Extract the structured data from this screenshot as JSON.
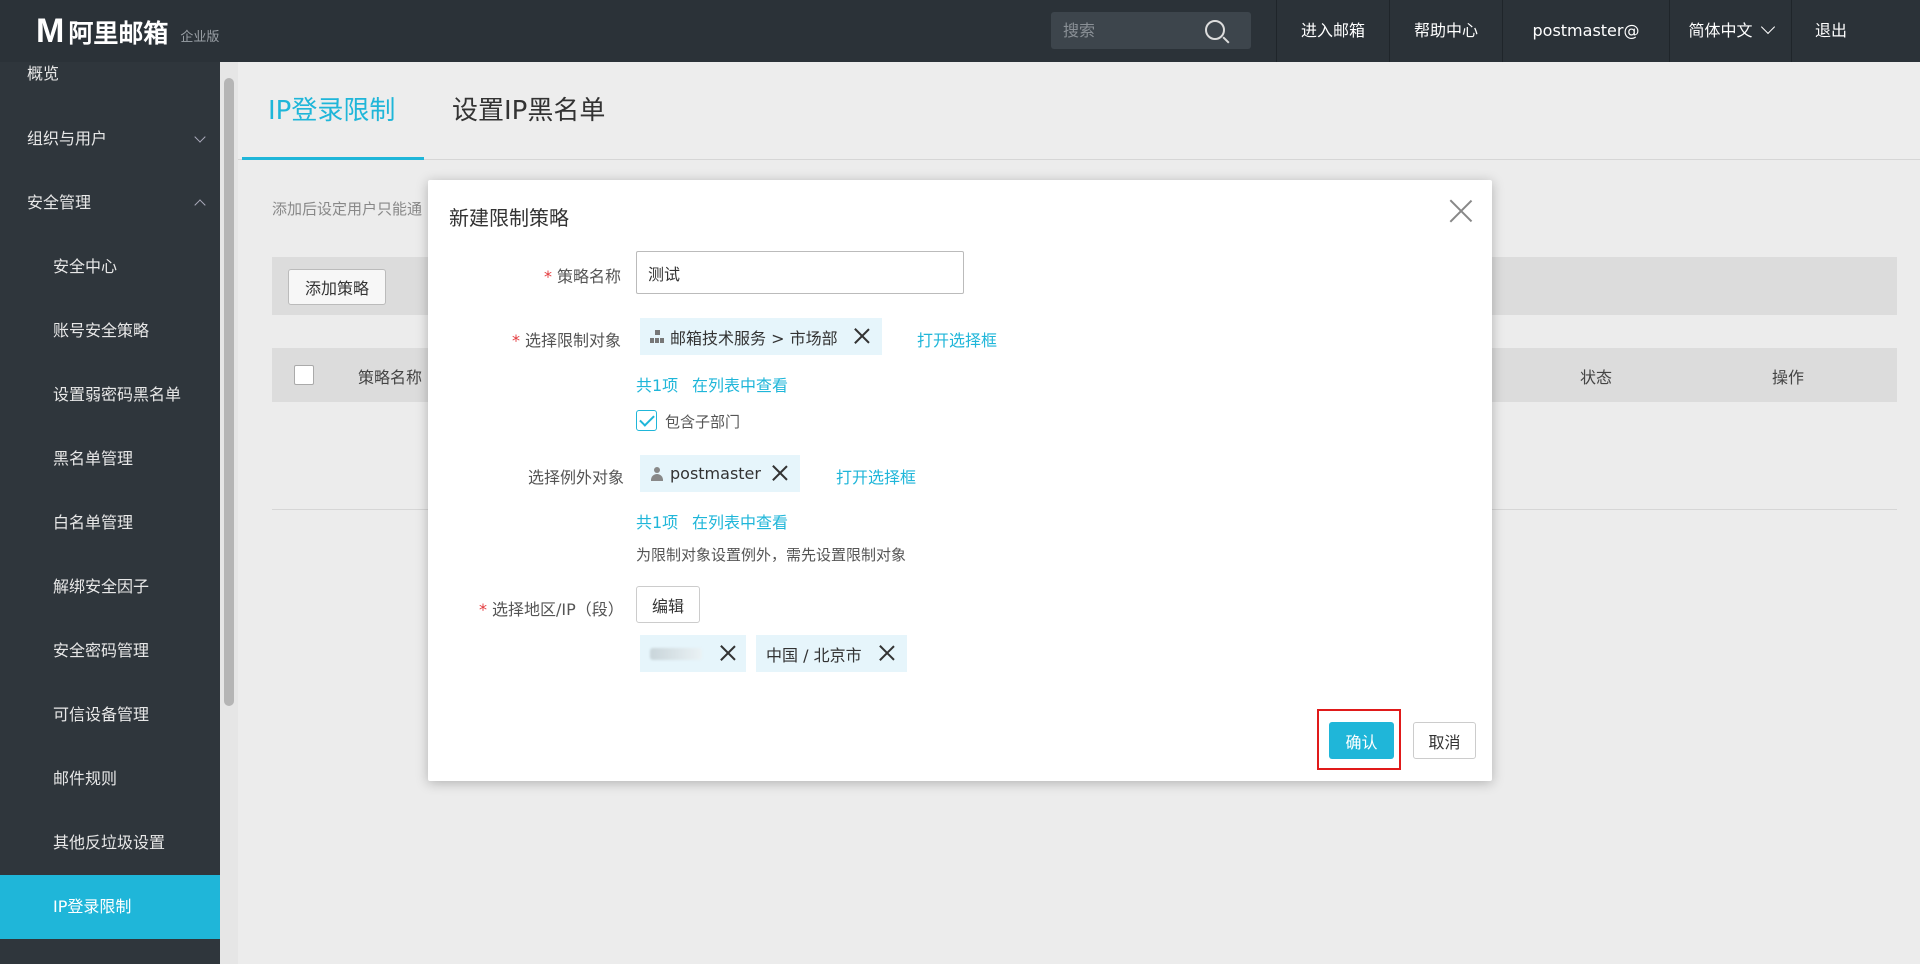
{
  "header": {
    "logo_mark": "M",
    "logo_text": "阿里邮箱",
    "logo_sub": "企业版",
    "search_placeholder": "搜索",
    "nav": [
      "进入邮箱",
      "帮助中心",
      "postmaster@",
      "简体中文",
      "退出"
    ]
  },
  "sidebar": {
    "items": [
      {
        "label": "概览"
      },
      {
        "label": "组织与用户"
      },
      {
        "label": "安全管理"
      },
      {
        "label": "安全中心"
      },
      {
        "label": "账号安全策略"
      },
      {
        "label": "设置弱密码黑名单"
      },
      {
        "label": "黑名单管理"
      },
      {
        "label": "白名单管理"
      },
      {
        "label": "解绑安全因子"
      },
      {
        "label": "安全密码管理"
      },
      {
        "label": "可信设备管理"
      },
      {
        "label": "邮件规则"
      },
      {
        "label": "其他反垃圾设置"
      },
      {
        "label": "IP登录限制"
      }
    ]
  },
  "main": {
    "tabs": [
      "IP登录限制",
      "设置IP黑名单"
    ],
    "description": "添加后设定用户只能通",
    "add_button": "添加策略",
    "columns": [
      "策略名称",
      "状态",
      "操作"
    ]
  },
  "modal": {
    "title": "新建限制策略",
    "name_label": "策略名称",
    "name_value": "测试",
    "target_label": "选择限制对象",
    "target_chip": "邮箱技术服务 > 市场部",
    "open_selector": "打开选择框",
    "target_count": "共1项",
    "view_in_list": "在列表中查看",
    "include_sub": "包含子部门",
    "exception_label": "选择例外对象",
    "exception_chip": "postmaster",
    "exception_count": "共1项",
    "exception_hint": "为限制对象设置例外，需先设置限制对象",
    "region_label": "选择地区/IP（段）",
    "edit_button": "编辑",
    "region_chip": "中国 / 北京市",
    "confirm": "确认",
    "cancel": "取消"
  },
  "colors": {
    "accent": "#1fb6d9",
    "topbar": "#2b3238",
    "sidebar": "#2f363c",
    "required": "#e4393c",
    "highlight_frame": "#e01a1a"
  }
}
